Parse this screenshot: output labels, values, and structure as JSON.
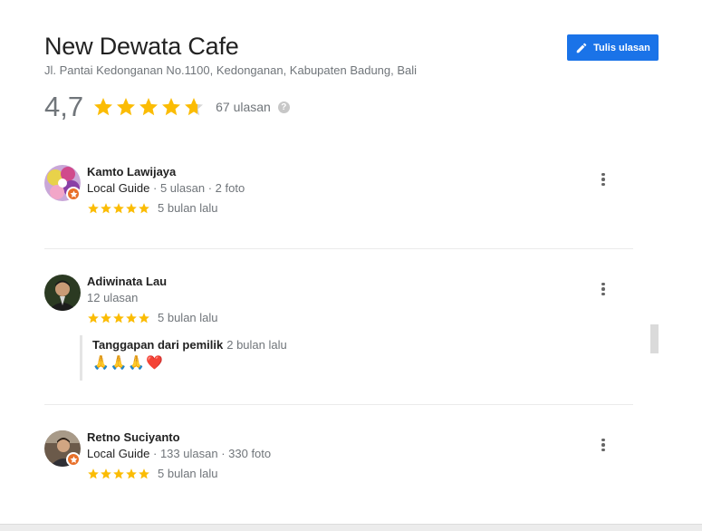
{
  "place": {
    "title": "New Dewata Cafe",
    "address": "Jl. Pantai Kedonganan No.1100, Kedonganan, Kabupaten Badung, Bali",
    "rating": "4,7",
    "rating_value": 4.7,
    "review_count": "67 ulasan",
    "help_glyph": "?"
  },
  "write_review": {
    "label": "Tulis ulasan",
    "icon": "pencil-icon"
  },
  "colors": {
    "accent": "#1a73e8",
    "star": "#fbbc04",
    "star_empty": "#d6d6d6",
    "guide_badge": "#e8702a"
  },
  "reviews": [
    {
      "name": "Kamto Lawijaya",
      "guide": "Local Guide",
      "sep": " · ",
      "reviews": "5 ulasan",
      "photos": "2 foto",
      "stars": 5,
      "time": "5 bulan lalu"
    },
    {
      "name": "Adiwinata Lau",
      "reviews": "12 ulasan",
      "stars": 5,
      "time": "5 bulan lalu",
      "owner_response": {
        "label": "Tanggapan dari pemilik",
        "time": "2 bulan lalu",
        "text": "🙏🙏🙏❤️"
      }
    },
    {
      "name": "Retno Suciyanto",
      "guide": "Local Guide",
      "sep": " · ",
      "reviews": "133 ulasan",
      "photos": "330 foto",
      "stars": 5,
      "time": "5 bulan lalu"
    }
  ]
}
